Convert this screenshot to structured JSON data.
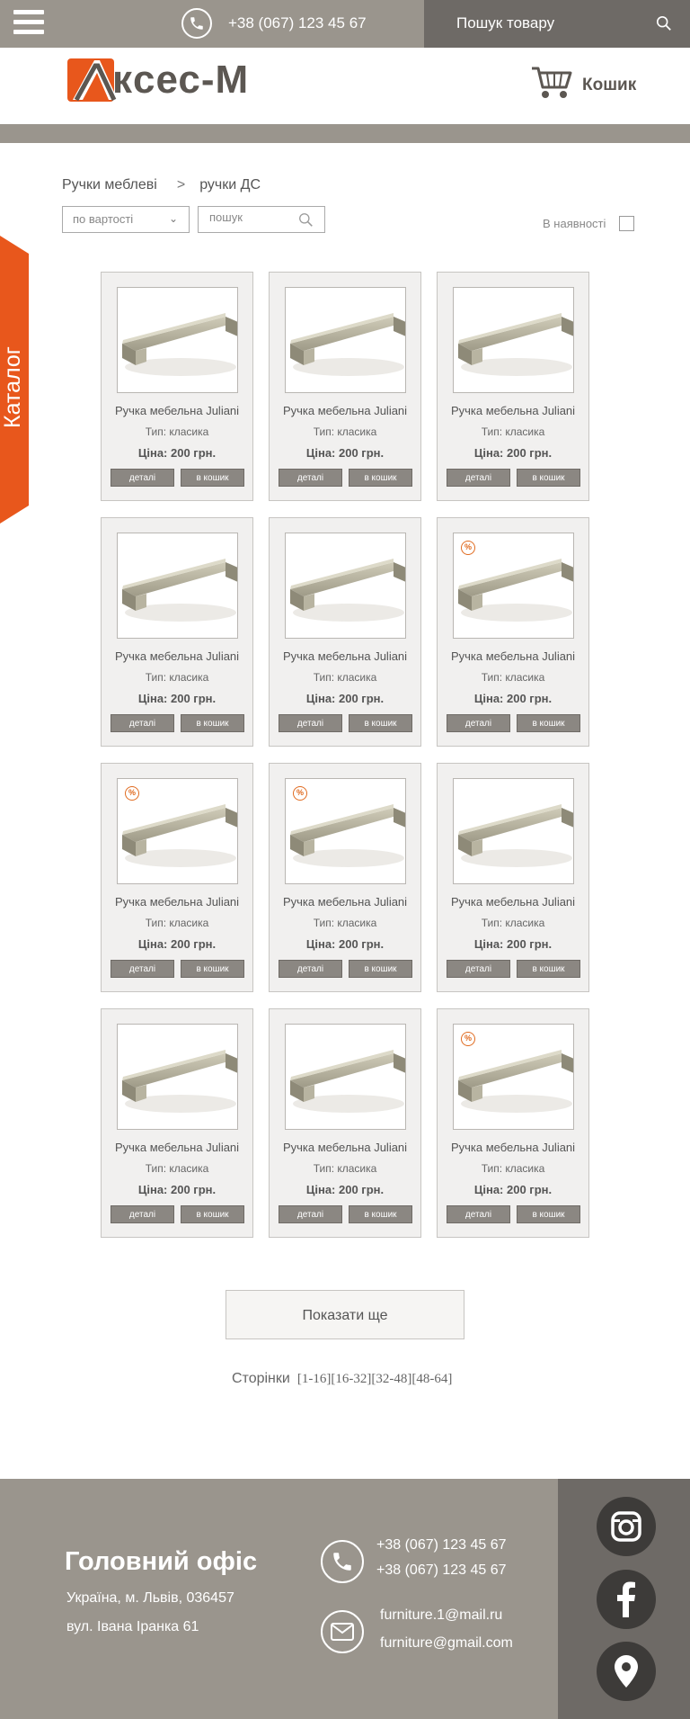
{
  "topbar": {
    "menu_icon": "hamburger-icon",
    "phone": "+38 (067) 123 45 67",
    "search_label": "Пошук товару",
    "search_icon": "search-icon"
  },
  "header": {
    "logo_text": "кcес-М",
    "logo_icon": "logo-a-mark",
    "cart_label": "Кошик",
    "cart_icon": "cart-icon"
  },
  "catalog_tab": {
    "label": "Каталог"
  },
  "breadcrumb": {
    "items": [
      "Ручки меблеві",
      "ручки ДС"
    ],
    "separator": ">"
  },
  "filters": {
    "sort_label": "по вартості",
    "search_placeholder": "пошук",
    "in_stock_label": "В наявності",
    "in_stock_checked": false
  },
  "products": [
    {
      "name": "Ручка мебельна Juliani",
      "type": "Тип: класика",
      "price": "Ціна: 200 грн.",
      "discount": false,
      "details_label": "деталі",
      "cart_label": "в кошик"
    },
    {
      "name": "Ручка мебельна Juliani",
      "type": "Тип: класика",
      "price": "Ціна: 200 грн.",
      "discount": false,
      "details_label": "деталі",
      "cart_label": "в кошик"
    },
    {
      "name": "Ручка мебельна Juliani",
      "type": "Тип: класика",
      "price": "Ціна: 200 грн.",
      "discount": false,
      "details_label": "деталі",
      "cart_label": "в кошик"
    },
    {
      "name": "Ручка мебельна Juliani",
      "type": "Тип: класика",
      "price": "Ціна: 200 грн.",
      "discount": false,
      "details_label": "деталі",
      "cart_label": "в кошик"
    },
    {
      "name": "Ручка мебельна Juliani",
      "type": "Тип: класика",
      "price": "Ціна: 200 грн.",
      "discount": false,
      "details_label": "деталі",
      "cart_label": "в кошик"
    },
    {
      "name": "Ручка мебельна Juliani",
      "type": "Тип: класика",
      "price": "Ціна: 200 грн.",
      "discount": true,
      "details_label": "деталі",
      "cart_label": "в кошик"
    },
    {
      "name": "Ручка мебельна Juliani",
      "type": "Тип: класика",
      "price": "Ціна: 200 грн.",
      "discount": true,
      "details_label": "деталі",
      "cart_label": "в кошик"
    },
    {
      "name": "Ручка мебельна Juliani",
      "type": "Тип: класика",
      "price": "Ціна: 200 грн.",
      "discount": true,
      "details_label": "деталі",
      "cart_label": "в кошик"
    },
    {
      "name": "Ручка мебельна Juliani",
      "type": "Тип: класика",
      "price": "Ціна: 200 грн.",
      "discount": false,
      "details_label": "деталі",
      "cart_label": "в кошик"
    },
    {
      "name": "Ручка мебельна Juliani",
      "type": "Тип: класика",
      "price": "Ціна: 200 грн.",
      "discount": false,
      "details_label": "деталі",
      "cart_label": "в кошик"
    },
    {
      "name": "Ручка мебельна Juliani",
      "type": "Тип: класика",
      "price": "Ціна: 200 грн.",
      "discount": false,
      "details_label": "деталі",
      "cart_label": "в кошик"
    },
    {
      "name": "Ручка мебельна Juliani",
      "type": "Тип: класика",
      "price": "Ціна: 200 грн.",
      "discount": true,
      "details_label": "деталі",
      "cart_label": "в кошик"
    }
  ],
  "discount_symbol": "%",
  "show_more_label": "Показати ще",
  "pagination": {
    "label": "Сторінки",
    "pages": [
      "[1-16]",
      "[16-32]",
      "[32-48]",
      "[48-64]"
    ]
  },
  "footer": {
    "office_title": "Головний офіс",
    "address_line1": "Україна, м. Львів, 036457",
    "address_line2": "вул. Івана Іранка 61",
    "phones": [
      "+38 (067) 123 45 67",
      "+38 (067) 123 45 67"
    ],
    "emails": [
      "furniture.1@mail.ru",
      "furniture@gmail.com"
    ],
    "social": [
      "instagram-icon",
      "facebook-icon",
      "location-pin-icon"
    ]
  },
  "colors": {
    "grey_bar": "#9a958d",
    "dark_grey": "#6e6a66",
    "accent_orange": "#e8571c",
    "button_grey": "#8b8782"
  }
}
